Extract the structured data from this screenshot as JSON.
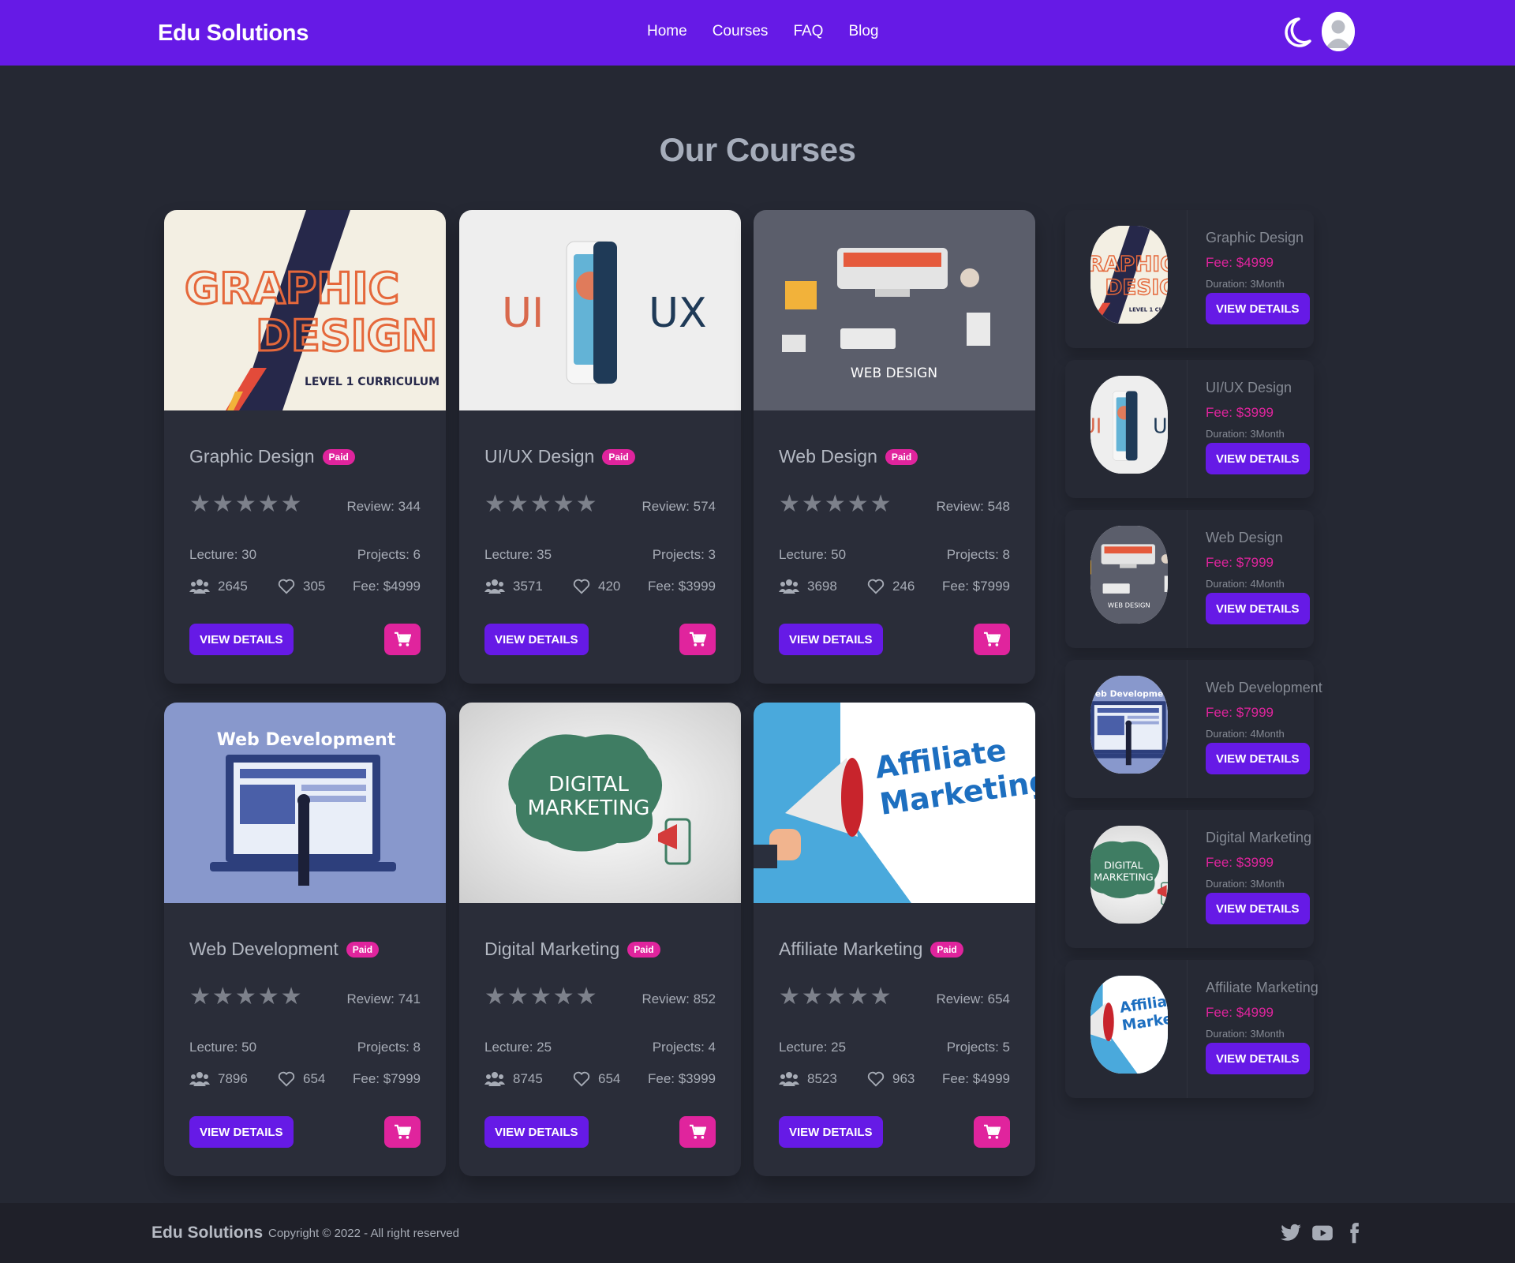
{
  "navbar": {
    "brand": "Edu Solutions",
    "links": [
      "Home",
      "Courses",
      "FAQ",
      "Blog"
    ],
    "theme_icon": "moon-icon",
    "avatar_icon": "user-avatar-icon",
    "background": "#661ae6"
  },
  "section_title": "Our Courses",
  "colors": {
    "primary": "#661ae6",
    "accent": "#e0249d",
    "page_bg": "#252833",
    "card_bg": "#2a2d39"
  },
  "courses": [
    {
      "title": "Graphic Design",
      "badge": "Paid",
      "rating": 5,
      "review": "Review: 344",
      "lecture": "Lecture: 30",
      "projects": "Projects: 6",
      "students": "2645",
      "likes": "305",
      "fee": "Fee: $4999",
      "details_label": "VIEW DETAILS",
      "image": {
        "line1": "GRAPHIC",
        "line2": "DESIGN",
        "sub": "LEVEL 1 CURRICULUM"
      }
    },
    {
      "title": "UI/UX Design",
      "badge": "Paid",
      "rating": 5,
      "review": "Review: 574",
      "lecture": "Lecture: 35",
      "projects": "Projects: 3",
      "students": "3571",
      "likes": "420",
      "fee": "Fee: $3999",
      "details_label": "VIEW DETAILS",
      "image": {
        "left": "UI",
        "right": "UX"
      }
    },
    {
      "title": "Web Design",
      "badge": "Paid",
      "rating": 5,
      "review": "Review: 548",
      "lecture": "Lecture: 50",
      "projects": "Projects: 8",
      "students": "3698",
      "likes": "246",
      "fee": "Fee: $7999",
      "details_label": "VIEW DETAILS",
      "image": {
        "caption": "WEB DESIGN"
      }
    },
    {
      "title": "Web Development",
      "badge": "Paid",
      "rating": 5,
      "review": "Review: 741",
      "lecture": "Lecture: 50",
      "projects": "Projects: 8",
      "students": "7896",
      "likes": "654",
      "fee": "Fee: $7999",
      "details_label": "VIEW DETAILS",
      "image": {
        "caption": "Web Development"
      }
    },
    {
      "title": "Digital Marketing",
      "badge": "Paid",
      "rating": 5,
      "review": "Review: 852",
      "lecture": "Lecture: 25",
      "projects": "Projects: 4",
      "students": "8745",
      "likes": "654",
      "fee": "Fee: $3999",
      "details_label": "VIEW DETAILS",
      "image": {
        "line1": "DIGITAL",
        "line2": "MARKETING"
      }
    },
    {
      "title": "Affiliate Marketing",
      "badge": "Paid",
      "rating": 5,
      "review": "Review: 654",
      "lecture": "Lecture: 25",
      "projects": "Projects: 5",
      "students": "8523",
      "likes": "963",
      "fee": "Fee: $4999",
      "details_label": "VIEW DETAILS",
      "image": {
        "line1": "Affiliate",
        "line2": "Marketing!"
      }
    }
  ],
  "sidebar": [
    {
      "title": "Graphic Design",
      "fee": "Fee: $4999",
      "duration": "Duration: 3Month",
      "button": "VIEW DETAILS"
    },
    {
      "title": "UI/UX Design",
      "fee": "Fee: $3999",
      "duration": "Duration: 3Month",
      "button": "VIEW DETAILS"
    },
    {
      "title": "Web Design",
      "fee": "Fee: $7999",
      "duration": "Duration: 4Month",
      "button": "VIEW DETAILS"
    },
    {
      "title": "Web Development",
      "fee": "Fee: $7999",
      "duration": "Duration: 4Month",
      "button": "VIEW DETAILS"
    },
    {
      "title": "Digital Marketing",
      "fee": "Fee: $3999",
      "duration": "Duration: 3Month",
      "button": "VIEW DETAILS"
    },
    {
      "title": "Affiliate Marketing",
      "fee": "Fee: $4999",
      "duration": "Duration: 3Month",
      "button": "VIEW DETAILS"
    }
  ],
  "footer": {
    "brand": "Edu Solutions",
    "copyright": "Copyright © 2022 - All right reserved",
    "social_icons": [
      "twitter-icon",
      "youtube-icon",
      "facebook-icon"
    ]
  }
}
